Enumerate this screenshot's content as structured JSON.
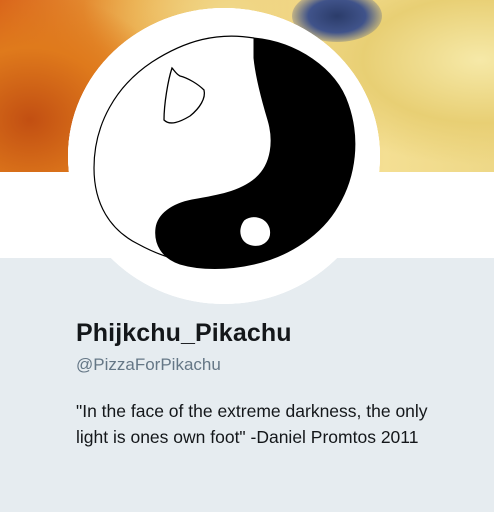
{
  "profile": {
    "display_name": "Phijkchu_Pikachu",
    "handle": "@PizzaForPikachu",
    "bio": "\"In the face of the extreme darkness, the only light is ones own foot\" -Daniel Promtos 2011"
  },
  "colors": {
    "background": "#e6ecf0",
    "name_text": "#14171a",
    "handle_text": "#657786",
    "avatar_ink": "#000000"
  },
  "icons": {
    "avatar": "yin-yang-doodle"
  }
}
